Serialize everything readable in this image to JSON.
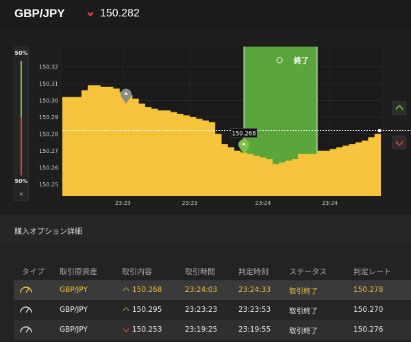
{
  "header": {
    "pair": "GBP/JPY",
    "price": "150.282",
    "direction": "down"
  },
  "ratio": {
    "top": "50%",
    "bottom": "50%",
    "close": "×"
  },
  "chart_data": {
    "type": "area",
    "yticks": [
      "150.32",
      "150.31",
      "150.30",
      "150.29",
      "150.28",
      "150.27",
      "150.26",
      "150.25"
    ],
    "ylim": [
      150.243,
      150.332
    ],
    "xticks": [
      "23:23",
      "23:23",
      "23:24",
      "23:24"
    ],
    "x": [
      0,
      2,
      4,
      6,
      8,
      10,
      12,
      14,
      16,
      18,
      20,
      22,
      24,
      26,
      28,
      30,
      32,
      34,
      36,
      38,
      40,
      42,
      44,
      46,
      48,
      50,
      52,
      54,
      56,
      58,
      60,
      62,
      64,
      66,
      68,
      70,
      72,
      74,
      76,
      78,
      80,
      82,
      84,
      86,
      88,
      90,
      92,
      94,
      96,
      98,
      100
    ],
    "values": [
      150.302,
      150.302,
      150.302,
      150.306,
      150.309,
      150.309,
      150.308,
      150.308,
      150.307,
      150.305,
      150.303,
      150.301,
      150.298,
      150.296,
      150.295,
      150.294,
      150.294,
      150.293,
      150.292,
      150.291,
      150.29,
      150.289,
      150.288,
      150.287,
      150.28,
      150.274,
      150.272,
      150.27,
      150.269,
      150.268,
      150.267,
      150.266,
      150.265,
      150.262,
      150.263,
      150.264,
      150.265,
      150.268,
      150.268,
      150.268,
      150.27,
      150.27,
      150.271,
      150.272,
      150.273,
      150.274,
      150.275,
      150.276,
      150.278,
      150.28,
      150.282
    ],
    "current_rate": "150.282",
    "entry_label": "150.268",
    "markers": [
      {
        "x": 20,
        "y": 150.298,
        "kind": "up-past"
      },
      {
        "x": 57,
        "y": 150.268,
        "kind": "up-active"
      }
    ],
    "active_window": {
      "x_start": 57,
      "x_end": 80,
      "label": "終了"
    }
  },
  "section": {
    "title": "購入オプション詳細"
  },
  "table": {
    "headers": [
      "タイプ",
      "取引原資産",
      "取引内容",
      "取引時間",
      "判定時刻",
      "ステータス",
      "判定レート"
    ],
    "rows": [
      {
        "asset": "GBP/JPY",
        "dir": "up",
        "content": "150.268",
        "time": "23:24:03",
        "judge": "23:24:33",
        "status": "取引終了",
        "rate": "150.278",
        "highlight": true
      },
      {
        "asset": "GBP/JPY",
        "dir": "up",
        "content": "150.295",
        "time": "23:23:23",
        "judge": "23:23:53",
        "status": "取引終了",
        "rate": "150.270",
        "highlight": false
      },
      {
        "asset": "GBP/JPY",
        "dir": "down",
        "content": "150.253",
        "time": "23:19:25",
        "judge": "23:19:55",
        "status": "取引終了",
        "rate": "150.276",
        "highlight": false
      }
    ]
  },
  "colors": {
    "up": "#7cc142",
    "down": "#e0453a",
    "area": "#f6c43a",
    "active": "#5aa63a",
    "accent": "#f2c230"
  }
}
